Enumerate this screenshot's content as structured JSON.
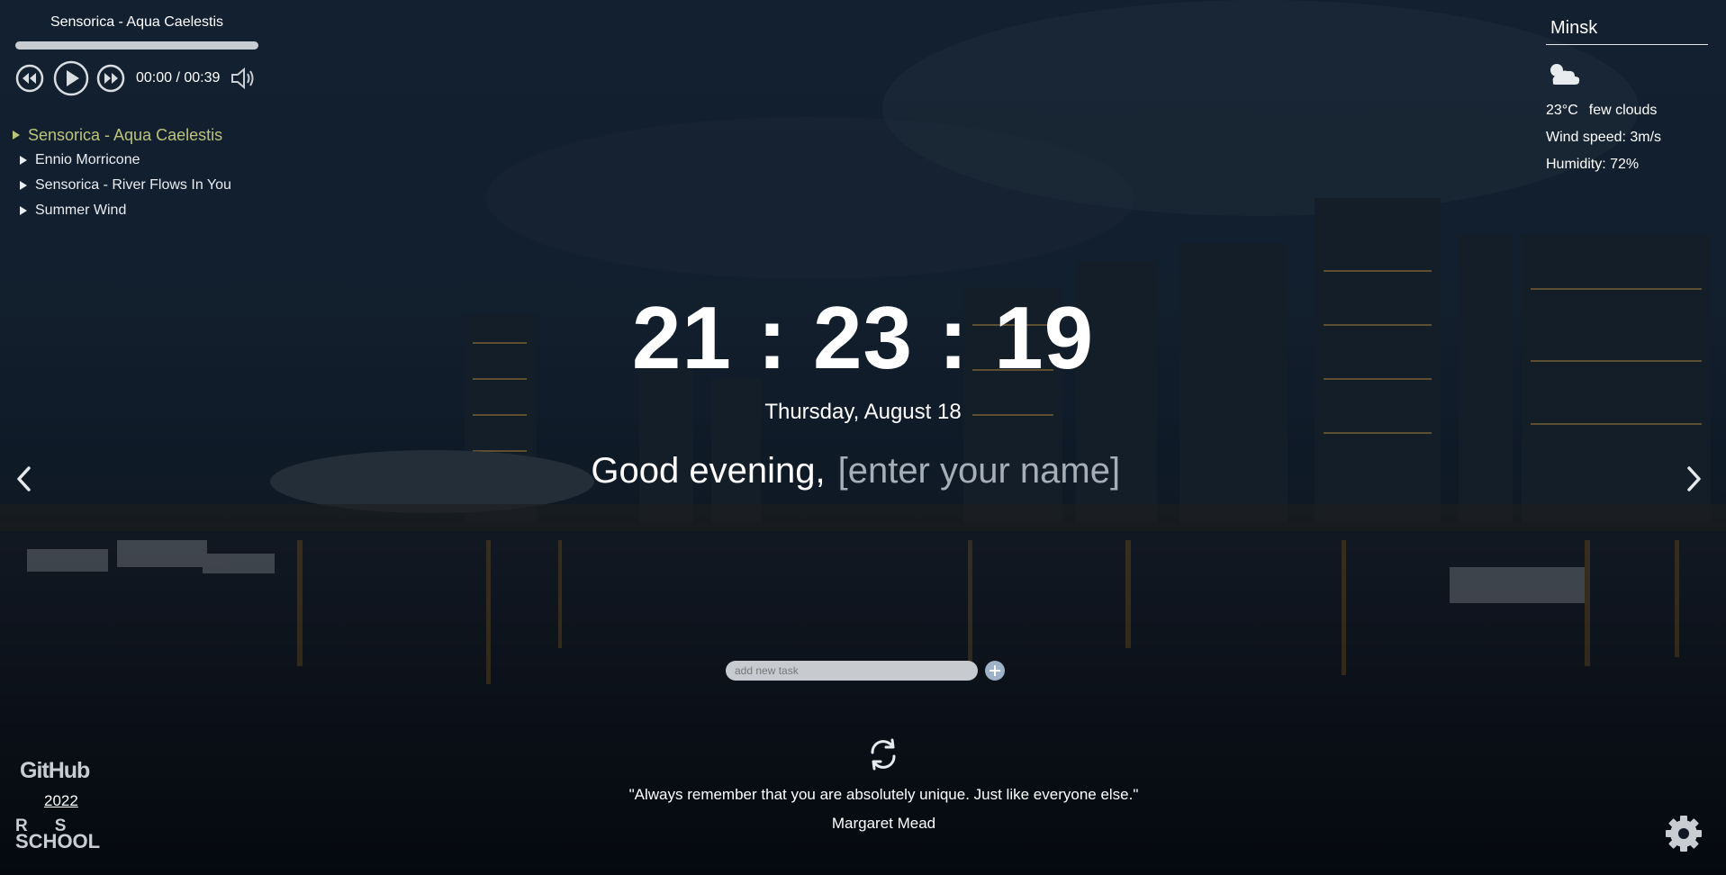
{
  "player": {
    "track_title": "Sensorica - Aqua Caelestis",
    "progress": 0,
    "time": "00:00 / 00:39",
    "playlist": [
      {
        "label": "Sensorica - Aqua Caelestis",
        "active": true
      },
      {
        "label": "Ennio Morricone",
        "active": false
      },
      {
        "label": "Sensorica - River Flows In You",
        "active": false
      },
      {
        "label": "Summer Wind",
        "active": false
      }
    ]
  },
  "weather": {
    "city": "Minsk",
    "icon": "few-clouds-icon",
    "temperature": "23°C",
    "description": "few clouds",
    "wind": "Wind speed: 3m/s",
    "humidity": "Humidity: 72%"
  },
  "clock": {
    "time": "21 : 23 : 19",
    "date": "Thursday, August 18"
  },
  "greeting": {
    "text": "Good evening,",
    "name_placeholder": "[enter your name]"
  },
  "todo": {
    "placeholder": "add new task"
  },
  "quote": {
    "text": "\"Always remember that you are absolutely unique. Just like everyone else.\"",
    "author": "Margaret Mead"
  },
  "footer": {
    "github": "GitHub",
    "year": "2022",
    "rs_line1": "RS",
    "rs_line2": "SCHOOL"
  },
  "colors": {
    "active_track": "#bcc47a",
    "progress_bar": "#c8cdd3",
    "background": "#0d1a2b"
  }
}
